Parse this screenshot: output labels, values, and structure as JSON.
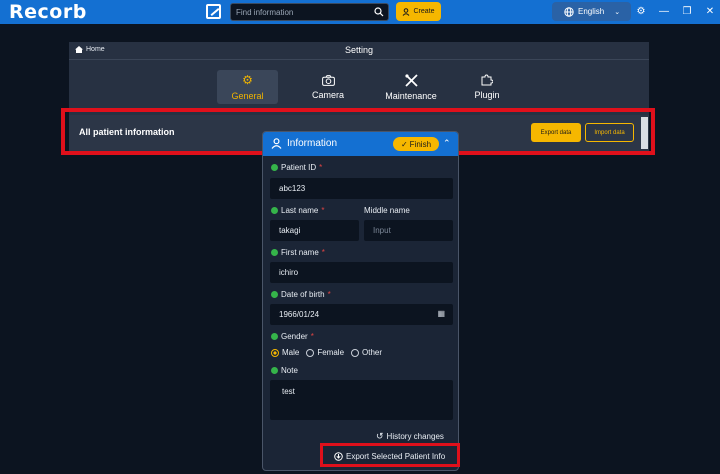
{
  "topbar": {
    "logo": "Recorb",
    "search_placeholder": "Find information",
    "create_label": "Create",
    "language": "English",
    "icons": [
      "settings-icon",
      "minimize-icon",
      "restore-icon",
      "close-icon"
    ]
  },
  "settings": {
    "breadcrumb": "Home",
    "title": "Setting",
    "tabs": [
      {
        "label": "General",
        "icon": "gear-icon",
        "active": true
      },
      {
        "label": "Camera",
        "icon": "camera-icon",
        "active": false
      },
      {
        "label": "Maintenance",
        "icon": "tools-icon",
        "active": false
      },
      {
        "label": "Plugin",
        "icon": "puzzle-icon",
        "active": false
      }
    ],
    "row_title": "All patient information",
    "export_label": "Export data",
    "import_label": "Import data"
  },
  "info": {
    "title": "Information",
    "finish_label": "Finish",
    "patient_id_label": "Patient ID",
    "patient_id_value": "abc123",
    "last_name_label": "Last name",
    "last_name_value": "takagi",
    "middle_name_label": "Middle name",
    "middle_name_placeholder": "Input",
    "first_name_label": "First name",
    "first_name_value": "ichiro",
    "dob_label": "Date of birth",
    "dob_value": "1966/01/24",
    "gender_label": "Gender",
    "gender_options": [
      "Male",
      "Female",
      "Other"
    ],
    "gender_selected": "Male",
    "note_label": "Note",
    "note_value": "test",
    "history_label": "History changes",
    "export_selected_label": "Export Selected Patient Info"
  },
  "colors": {
    "accent": "#f6b700",
    "topbar": "#1470d2",
    "highlight": "#e0101b",
    "status_dot": "#35b44a"
  }
}
